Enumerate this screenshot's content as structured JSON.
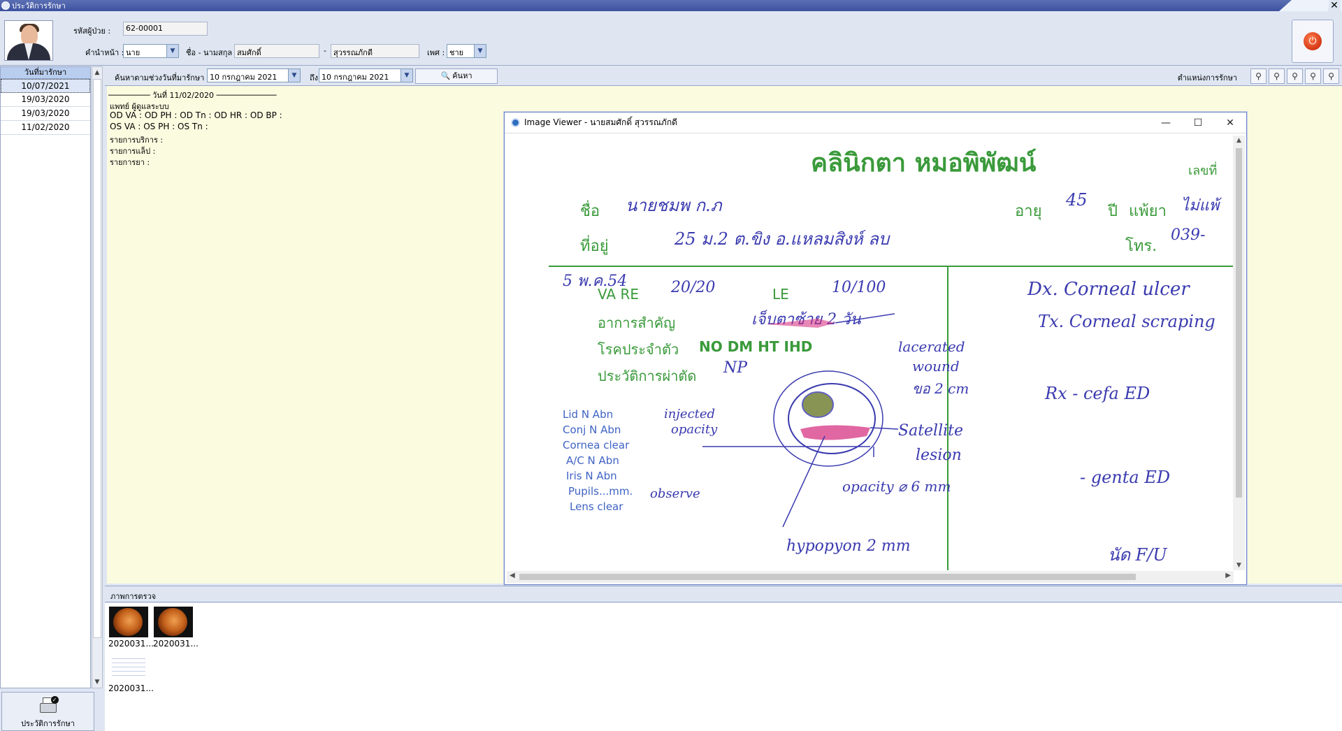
{
  "window": {
    "title": "ประวัติการรักษา",
    "close": "✕"
  },
  "patient": {
    "hn_label": "รหัสผู้ป่วย :",
    "hn": "62-00001",
    "prefix_label": "คำนำหน้า :",
    "prefix": "นาย",
    "name_label": "ชื่อ - นามสกุล :",
    "first_name": "สมศักดิ์",
    "dash": "-",
    "last_name": "สุวรรณภักดี",
    "sex_label": "เพศ :",
    "sex": "ชาย"
  },
  "date_list": {
    "header": "วันที่มารักษา",
    "items": [
      "10/07/2021",
      "19/03/2020",
      "19/03/2020",
      "11/02/2020"
    ],
    "selected_index": 0
  },
  "search": {
    "range_label": "ค้นหาตามช่วงวันที่มารักษา",
    "from_date": "10 กรกฎาคม  2021",
    "to_label": "ถึง",
    "to_date": "10 กรกฎาคม  2021",
    "button": "ค้นหา",
    "location_label": "ตำแหน่งการรักษา"
  },
  "record": {
    "divider": "───────── วันที่ 11/02/2020 ─────────────",
    "doctor": "แพทย์ ผู้ดูแลระบบ",
    "od_line": "OD VA :   OD PH :   OD Tn :   OD HR :   OD BP :",
    "os_line": "OS VA :   OS PH :   OS Tn :",
    "service": "รายการบริการ :",
    "lab": "รายการแล็ป :",
    "drug": "รายการยา :"
  },
  "images": {
    "header": "ภาพการตรวจ",
    "items": [
      "2020031...",
      "2020031...",
      "2020031..."
    ]
  },
  "print_button": "ประวัติการรักษา",
  "viewer": {
    "title": "Image Viewer - นายสมศักดิ์ สุวรรณภักดี",
    "minimize": "—",
    "maximize": "☐",
    "close": "✕",
    "doc": {
      "clinic": "คลินิกตา หมอพิพัฒน์",
      "number_label": "เลขที่",
      "name_label": "ชื่อ",
      "name_value": "นายชมพ ก.ภ",
      "age_label": "อายุ",
      "age_value": "45",
      "year_label": "ปี",
      "allergy_label": "แพ้ยา",
      "allergy_value": "ไม่แพ้",
      "address_label": "ที่อยู่",
      "address_value": "25 ม.2 ต.ขิง อ.แหลมสิงห์ ลบ",
      "phone_label": "โทร.",
      "phone_value": "039-",
      "date_note": "5 พ.ค.54",
      "va_label": "VA RE",
      "va_re": "20/20",
      "le_label": "LE",
      "va_le": "10/100",
      "complaint_label": "อาการสำคัญ",
      "complaint": "เจ็บตาซ้าย 2 วัน",
      "disease_label": "โรคประจำตัว",
      "disease_value": "NO DM HT IHD",
      "surgery_label": "ประวัติการผ่าตัด",
      "surgery_value": "NP",
      "dx": "Dx. Corneal ulcer",
      "tx": "Tx. Corneal scraping",
      "rx1": "Rx - cefa ED",
      "rx2": "- genta ED",
      "fu": "นัด F/U",
      "lid": "Lid N Abn",
      "conj": "Conj N Abn",
      "cornea": "Cornea clear",
      "ac": "A/C  N  Abn",
      "iris": "Iris  N  Abn",
      "pupils": "Pupils...mm.",
      "lens": "Lens  clear",
      "injected": "injected",
      "opacity": "opacity",
      "observe": "observe",
      "lacerated": "lacerated",
      "wound": "wound",
      "two_cm": "ขอ 2 cm",
      "satellite": "Satellite",
      "lesion": "lesion",
      "opacity_size": "opacity ⌀ 6 mm",
      "hypopyon": "hypopyon 2 mm"
    }
  }
}
